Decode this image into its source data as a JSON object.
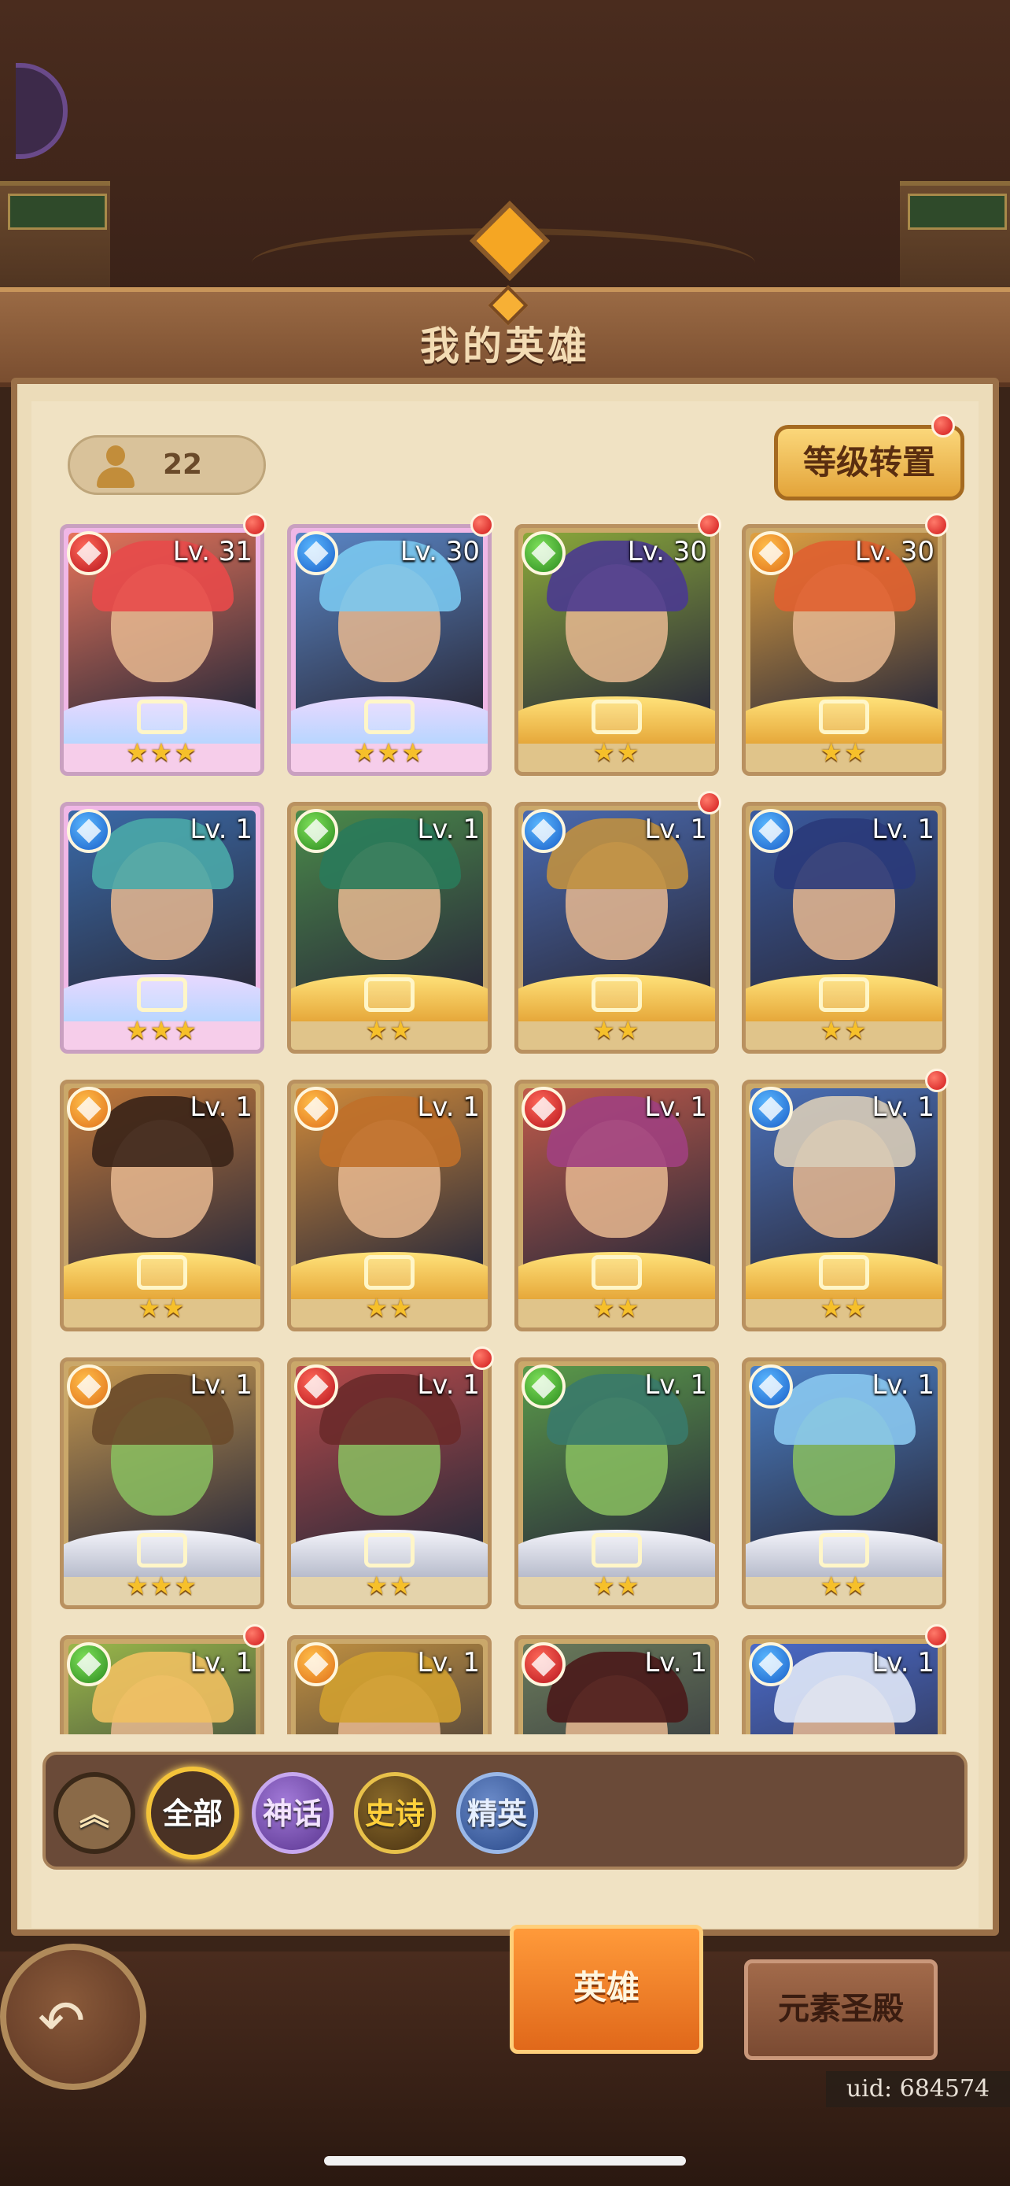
{
  "title": "我的英雄",
  "hero_count": "22",
  "level_transfer_label": "等级转置",
  "heroes": [
    {
      "level": "Lv. 31",
      "element": "red",
      "rarity": "mythic",
      "stars": "★★★",
      "alert": true,
      "art": "#e7745a",
      "hair": "#e84a4a"
    },
    {
      "level": "Lv. 30",
      "element": "blue",
      "rarity": "mythic",
      "stars": "★★★",
      "alert": true,
      "art": "#5a86c6",
      "hair": "#7ac8ef"
    },
    {
      "level": "Lv. 30",
      "element": "green",
      "rarity": "epic",
      "stars": "★★",
      "alert": true,
      "art": "#8aa83a",
      "hair": "#4a3a90"
    },
    {
      "level": "Lv. 30",
      "element": "orange",
      "rarity": "epic",
      "stars": "★★",
      "alert": true,
      "art": "#e0a040",
      "hair": "#e06030"
    },
    {
      "level": "Lv. 1",
      "element": "blue",
      "rarity": "mythic",
      "stars": "★★★",
      "alert": false,
      "art": "#3a6aa8",
      "hair": "#4aa8a8"
    },
    {
      "level": "Lv. 1",
      "element": "green",
      "rarity": "epic",
      "stars": "★★",
      "alert": false,
      "art": "#4a8a4a",
      "hair": "#2a7a5a"
    },
    {
      "level": "Lv. 1",
      "element": "blue",
      "rarity": "epic",
      "stars": "★★",
      "alert": true,
      "art": "#4a6ab0",
      "hair": "#c09040"
    },
    {
      "level": "Lv. 1",
      "element": "blue",
      "rarity": "epic",
      "stars": "★★",
      "alert": false,
      "art": "#3a5aa0",
      "hair": "#2a3a7a"
    },
    {
      "level": "Lv. 1",
      "element": "orange",
      "rarity": "epic",
      "stars": "★★",
      "alert": false,
      "art": "#c0783a",
      "hair": "#3a2418"
    },
    {
      "level": "Lv. 1",
      "element": "orange",
      "rarity": "epic",
      "stars": "★★",
      "alert": false,
      "art": "#d08a3a",
      "hair": "#c0702a"
    },
    {
      "level": "Lv. 1",
      "element": "red",
      "rarity": "epic",
      "stars": "★★",
      "alert": false,
      "art": "#c05a4a",
      "hair": "#a04080"
    },
    {
      "level": "Lv. 1",
      "element": "blue",
      "rarity": "epic",
      "stars": "★★",
      "alert": true,
      "art": "#4a70b8",
      "hair": "#d8ccb8"
    },
    {
      "level": "Lv. 1",
      "element": "orange",
      "rarity": "elite",
      "stars": "★★★",
      "alert": false,
      "art": "#c89a50",
      "hair": "#6a4a2a"
    },
    {
      "level": "Lv. 1",
      "element": "red",
      "rarity": "elite",
      "stars": "★★",
      "alert": true,
      "art": "#b84a4a",
      "hair": "#6a2a2a"
    },
    {
      "level": "Lv. 1",
      "element": "green",
      "rarity": "elite",
      "stars": "★★",
      "alert": false,
      "art": "#5a9a4a",
      "hair": "#3a7a6a"
    },
    {
      "level": "Lv. 1",
      "element": "blue",
      "rarity": "elite",
      "stars": "★★",
      "alert": false,
      "art": "#4a80c8",
      "hair": "#8ac8ef"
    },
    {
      "level": "Lv. 1",
      "element": "green",
      "rarity": "epic",
      "stars": "",
      "alert": true,
      "art": "#9ab84a",
      "hair": "#f0c060"
    },
    {
      "level": "Lv. 1",
      "element": "orange",
      "rarity": "epic",
      "stars": "",
      "alert": false,
      "art": "#c09040",
      "hair": "#d0a030"
    },
    {
      "level": "Lv. 1",
      "element": "red",
      "rarity": "epic",
      "stars": "",
      "alert": false,
      "art": "#6a7a5a",
      "hair": "#4a1a1a"
    },
    {
      "level": "Lv. 1",
      "element": "blue",
      "rarity": "epic",
      "stars": "",
      "alert": true,
      "art": "#4a6ac8",
      "hair": "#e0e8f8"
    }
  ],
  "filters": {
    "all": "全部",
    "mythic": "神话",
    "epic": "史诗",
    "elite": "精英"
  },
  "tabs": {
    "heroes": "英雄",
    "element_shrine": "元素圣殿"
  },
  "uid": "uid: 684574"
}
